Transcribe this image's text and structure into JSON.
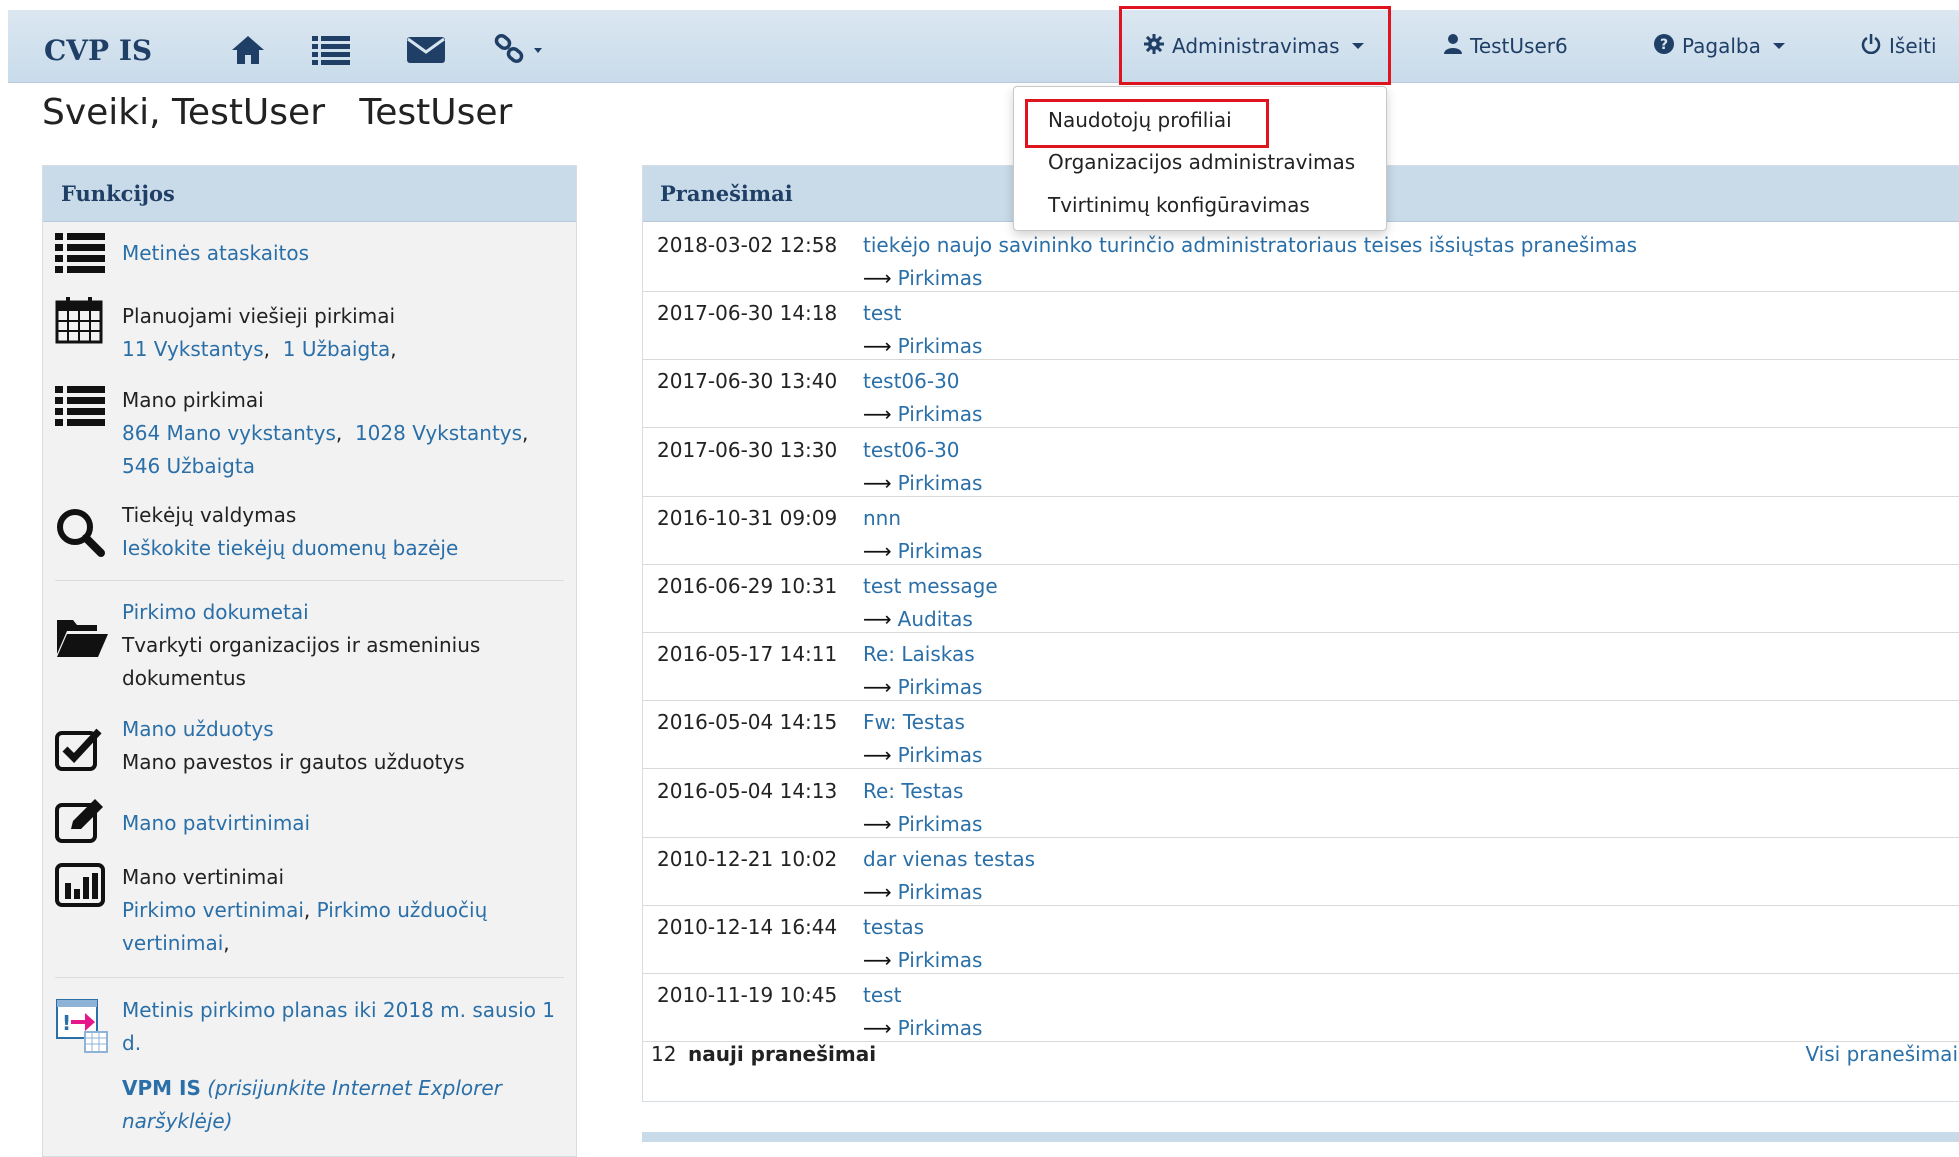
{
  "navbar": {
    "brand": "CVP IS",
    "admin_label": "Administravimas",
    "user_label": "TestUser6",
    "help_label": "Pagalba",
    "logout_label": "Išeiti"
  },
  "admin_menu": {
    "items": [
      "Naudotojų profiliai",
      "Organizacijos administravimas",
      "Tvirtinimų konfigūravimas"
    ]
  },
  "greeting": "Sveiki, TestUser   TestUser",
  "functions": {
    "title": "Funkcijos",
    "annual_reports": "Metinės ataskaitos",
    "planned_title": "Planuojami viešieji pirkimai",
    "planned_ongoing": "11 Vykstantys",
    "planned_completed": "1 Užbaigta",
    "my_purchases_title": "Mano pirkimai",
    "my_ongoing": "864 Mano vykstantys",
    "ongoing": "1028 Vykstantys",
    "completed": "546 Užbaigta",
    "suppliers_title": "Tiekėjų valdymas",
    "suppliers_link": "Ieškokite tiekėjų duomenų bazėje",
    "docs_link": "Pirkimo dokumetai",
    "docs_desc": "Tvarkyti organizacijos ir asmeninius dokumentus",
    "tasks_link": "Mano užduotys",
    "tasks_desc": "Mano pavestos ir gautos užduotys",
    "approvals_link": "Mano patvirtinimai",
    "ratings_title": "Mano vertinimai",
    "ratings_link1": "Pirkimo vertinimai",
    "ratings_link2": "Pirkimo užduočių vertinimai",
    "plan_link": "Metinis pirkimo planas iki 2018 m. sausio 1 d.",
    "vpm_bold": "VPM IS",
    "vpm_note": "(prisijunkite Internet Explorer naršyklėje)"
  },
  "messages": {
    "title": "Pranešimai",
    "items": [
      {
        "date": "2018-03-02 12:58",
        "title": "tiekėjo naujo savininko turinčio administratoriaus teises išsiųstas pranešimas",
        "category": "Pirkimas"
      },
      {
        "date": "2017-06-30 14:18",
        "title": "test",
        "category": "Pirkimas"
      },
      {
        "date": "2017-06-30 13:40",
        "title": "test06-30",
        "category": "Pirkimas"
      },
      {
        "date": "2017-06-30 13:30",
        "title": "test06-30",
        "category": "Pirkimas"
      },
      {
        "date": "2016-10-31 09:09",
        "title": "nnn",
        "category": "Pirkimas"
      },
      {
        "date": "2016-06-29 10:31",
        "title": "test message",
        "category": "Auditas"
      },
      {
        "date": "2016-05-17 14:11",
        "title": "Re: Laiskas",
        "category": "Pirkimas"
      },
      {
        "date": "2016-05-04 14:15",
        "title": "Fw: Testas",
        "category": "Pirkimas"
      },
      {
        "date": "2016-05-04 14:13",
        "title": "Re: Testas",
        "category": "Pirkimas"
      },
      {
        "date": "2010-12-21 10:02",
        "title": "dar vienas testas",
        "category": "Pirkimas"
      },
      {
        "date": "2010-12-14 16:44",
        "title": "testas",
        "category": "Pirkimas"
      },
      {
        "date": "2010-11-19 10:45",
        "title": "test",
        "category": "Pirkimas"
      }
    ],
    "new_count": "12",
    "new_label": "nauji pranešimai",
    "all_link": "Visi pranešimai"
  },
  "colors": {
    "accent": "#2a6fa8",
    "navbar": "#c9dbea",
    "highlight": "#e0141e"
  }
}
